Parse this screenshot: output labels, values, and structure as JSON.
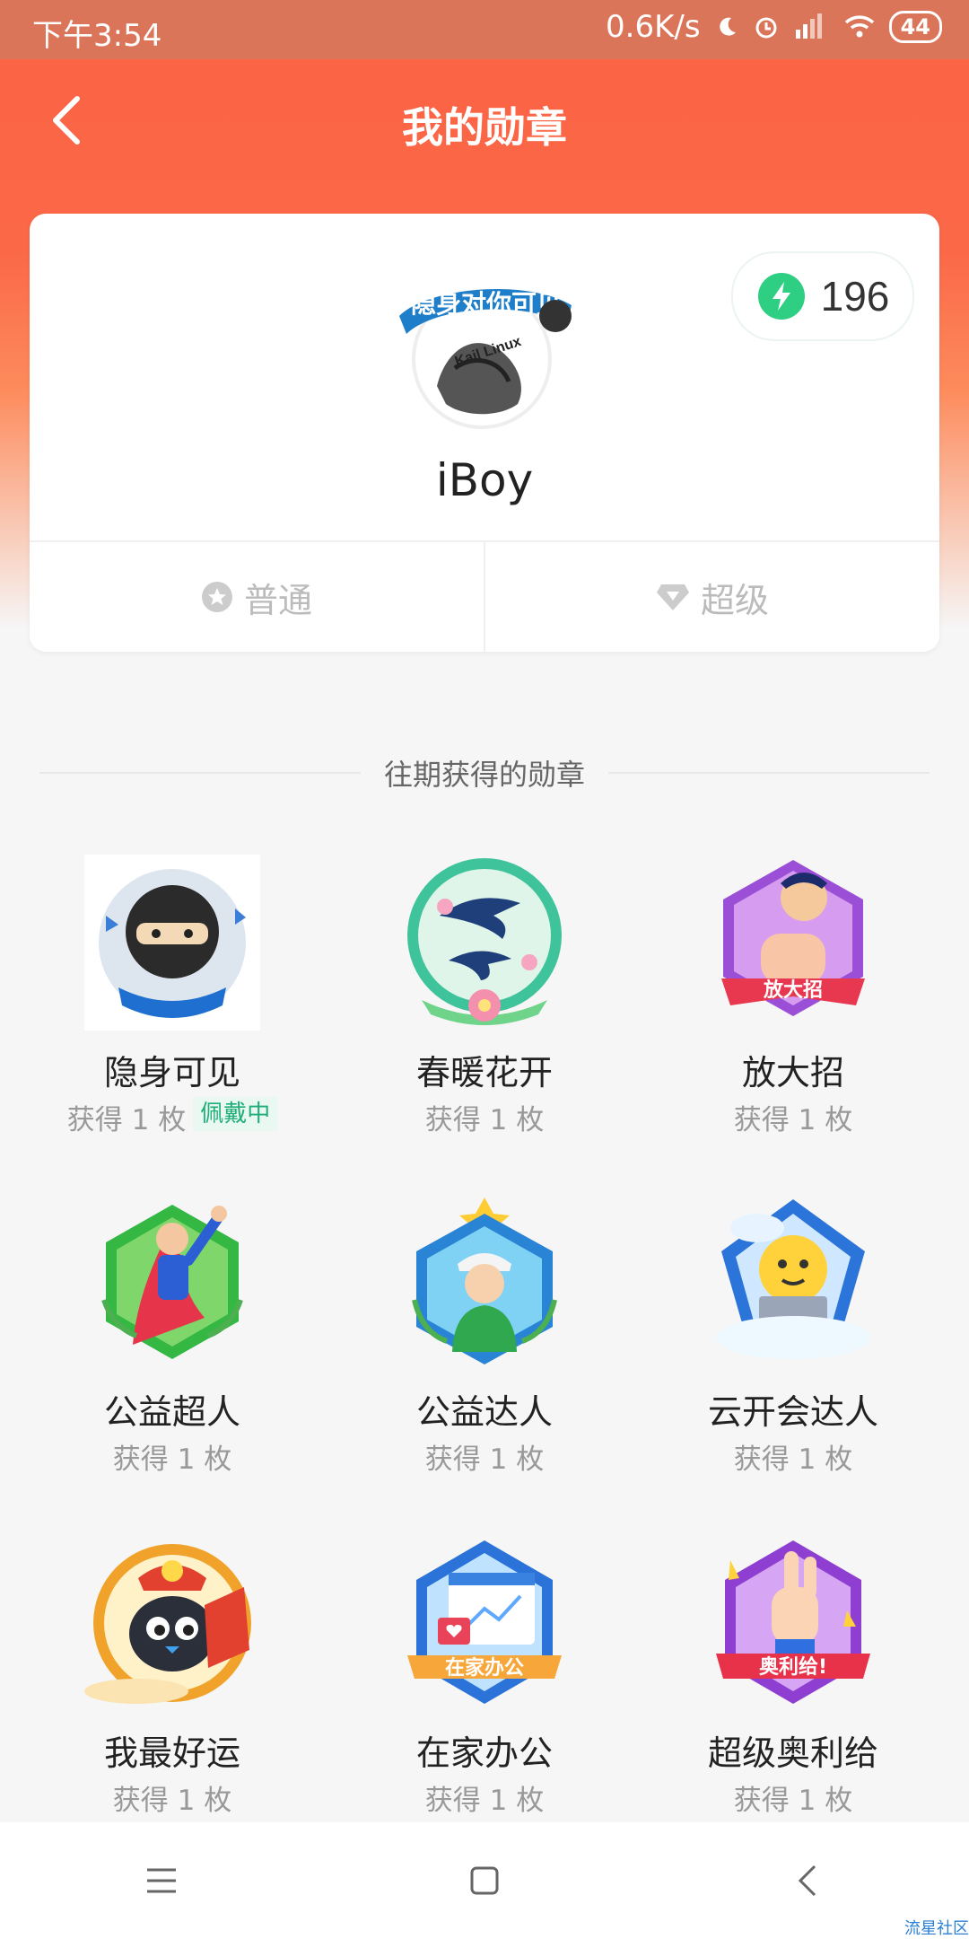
{
  "status_bar": {
    "time": "下午3:54",
    "speed": "0.6K/s",
    "battery": "44"
  },
  "header": {
    "title": "我的勋章"
  },
  "profile": {
    "avatar_text": "隐身对你可见",
    "avatar_subtext": "Kail Linux",
    "username": "iBoy",
    "points": "196",
    "points_color": "#2ecf82"
  },
  "tabs": [
    {
      "label": "普通"
    },
    {
      "label": "超级"
    }
  ],
  "section_title": "往期获得的勋章",
  "badges": [
    {
      "name": "隐身可见",
      "count": "获得 1 枚",
      "tag": "佩戴中",
      "icon": "ninja-badge-icon"
    },
    {
      "name": "春暖花开",
      "count": "获得 1 枚",
      "icon": "swallow-flower-badge-icon"
    },
    {
      "name": "放大招",
      "count": "获得 1 枚",
      "icon": "punch-badge-icon",
      "ribbon": "放大招"
    },
    {
      "name": "公益超人",
      "count": "获得 1 枚",
      "icon": "superman-badge-icon"
    },
    {
      "name": "公益达人",
      "count": "获得 1 枚",
      "icon": "volunteer-badge-icon"
    },
    {
      "name": "云开会达人",
      "count": "获得 1 枚",
      "icon": "cloud-meeting-badge-icon"
    },
    {
      "name": "我最好运",
      "count": "获得 1 枚",
      "icon": "lucky-badge-icon"
    },
    {
      "name": "在家办公",
      "count": "获得 1 枚",
      "icon": "home-office-badge-icon",
      "ribbon": "在家办公"
    },
    {
      "name": "超级奥利给",
      "count": "获得 1 枚",
      "icon": "thumb-badge-icon",
      "ribbon": "奥利给!"
    }
  ],
  "watermark": "流星社区",
  "colors": {
    "header": "#fb6343",
    "accent_green": "#1fae7a"
  }
}
